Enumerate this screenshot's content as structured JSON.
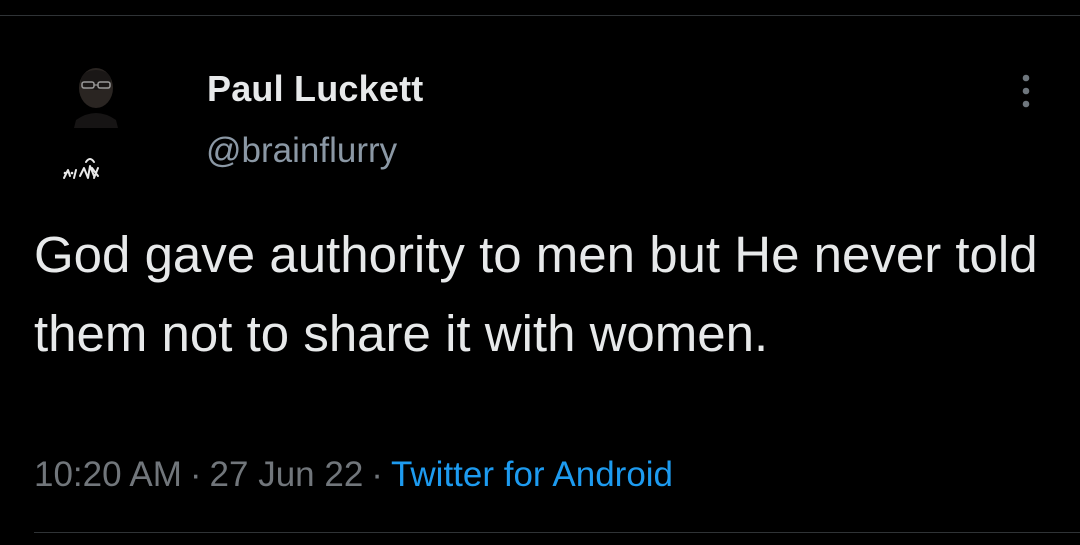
{
  "author": {
    "display_name": "Paul Luckett",
    "handle": "@brainflurry",
    "avatar_icon": "avatar-portrait-with-signature"
  },
  "menu": {
    "icon": "more-vertical-icon"
  },
  "tweet": {
    "text": "God gave authority to men but He never told them not to share it with women.",
    "time": "10:20 AM",
    "date": "27 Jun 22",
    "separator": "·",
    "source": "Twitter for Android"
  },
  "colors": {
    "background": "#000000",
    "primary_text": "#e7e9ea",
    "secondary_text": "#71767b",
    "link": "#1d9bf0",
    "divider": "#2f3336"
  }
}
